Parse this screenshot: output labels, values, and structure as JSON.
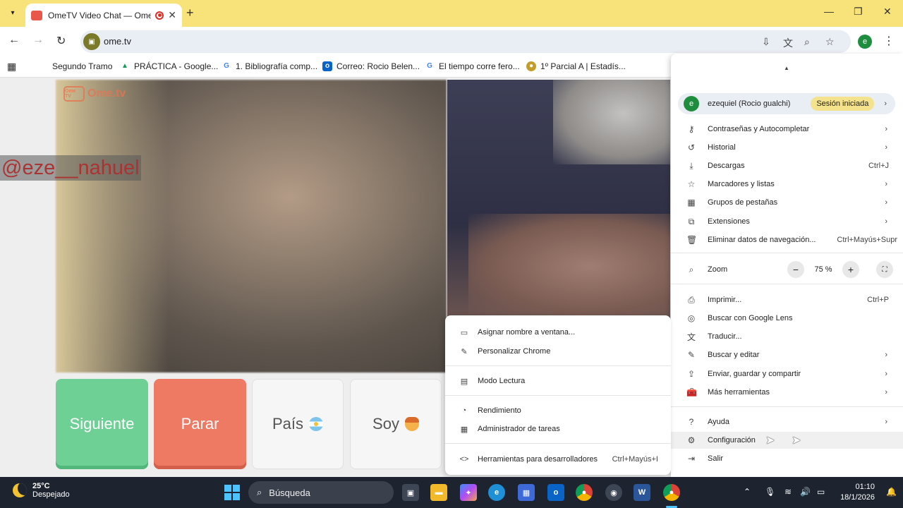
{
  "browser": {
    "tab_title": "OmeTV Video Chat — Ome",
    "url": "ome.tv",
    "profile_initial": "e"
  },
  "bookmarks": [
    {
      "label": "Segundo Tramo"
    },
    {
      "label": "PRÁCTICA - Google..."
    },
    {
      "label": "1. Bibliografía comp..."
    },
    {
      "label": "Correo: Rocio Belen..."
    },
    {
      "label": "El tiempo corre fero..."
    },
    {
      "label": "1º Parcial A | Estadís..."
    }
  ],
  "page": {
    "logo_text": "Ome.tv",
    "logo_badge": "Ome TV",
    "handle_overlay": "@eze__nahuel",
    "buttons": {
      "next": "Siguiente",
      "stop": "Parar",
      "country": "País",
      "soy": "Soy"
    }
  },
  "chrome_menu": {
    "profile_name": "ezequiel (Rocio gualchi)",
    "profile_initial": "e",
    "session_badge": "Sesión iniciada",
    "items": [
      {
        "label": "Contraseñas y Autocompletar",
        "shortcut": "",
        "icon": "key-icon"
      },
      {
        "label": "Historial",
        "shortcut": "",
        "icon": "history-icon"
      },
      {
        "label": "Descargas",
        "shortcut": "Ctrl+J",
        "icon": "download-icon"
      },
      {
        "label": "Marcadores y listas",
        "shortcut": "",
        "icon": "star-icon"
      },
      {
        "label": "Grupos de pestañas",
        "shortcut": "",
        "icon": "tab-groups-icon"
      },
      {
        "label": "Extensiones",
        "shortcut": "",
        "icon": "extensions-icon"
      },
      {
        "label": "Eliminar datos de navegación...",
        "shortcut": "Ctrl+Mayús+Supr",
        "icon": "trash-icon"
      }
    ],
    "zoom": {
      "label": "Zoom",
      "value": "75 %",
      "minus": "−",
      "plus": "+"
    },
    "items2": [
      {
        "label": "Imprimir...",
        "shortcut": "Ctrl+P"
      },
      {
        "label": "Buscar con Google Lens",
        "shortcut": ""
      },
      {
        "label": "Traducir...",
        "shortcut": ""
      },
      {
        "label": "Buscar y editar",
        "shortcut": ""
      },
      {
        "label": "Enviar, guardar y compartir",
        "shortcut": ""
      },
      {
        "label": "Más herramientas",
        "shortcut": ""
      }
    ],
    "items3": [
      {
        "label": "Ayuda"
      },
      {
        "label": "Configuración"
      },
      {
        "label": "Salir"
      }
    ]
  },
  "submenu": {
    "items": [
      {
        "label": "Asignar nombre a ventana...",
        "shortcut": ""
      },
      {
        "label": "Personalizar Chrome",
        "shortcut": ""
      },
      {
        "label": "Modo Lectura",
        "shortcut": ""
      },
      {
        "label": "Rendimiento",
        "shortcut": ""
      },
      {
        "label": "Administrador de tareas",
        "shortcut": ""
      },
      {
        "label": "Herramientas para desarrolladores",
        "shortcut": "Ctrl+Mayús+I"
      }
    ]
  },
  "taskbar": {
    "temp": "25°C",
    "weather": "Despejado",
    "search_placeholder": "Búsqueda",
    "time": "01:10",
    "date": "18/1/2026"
  }
}
